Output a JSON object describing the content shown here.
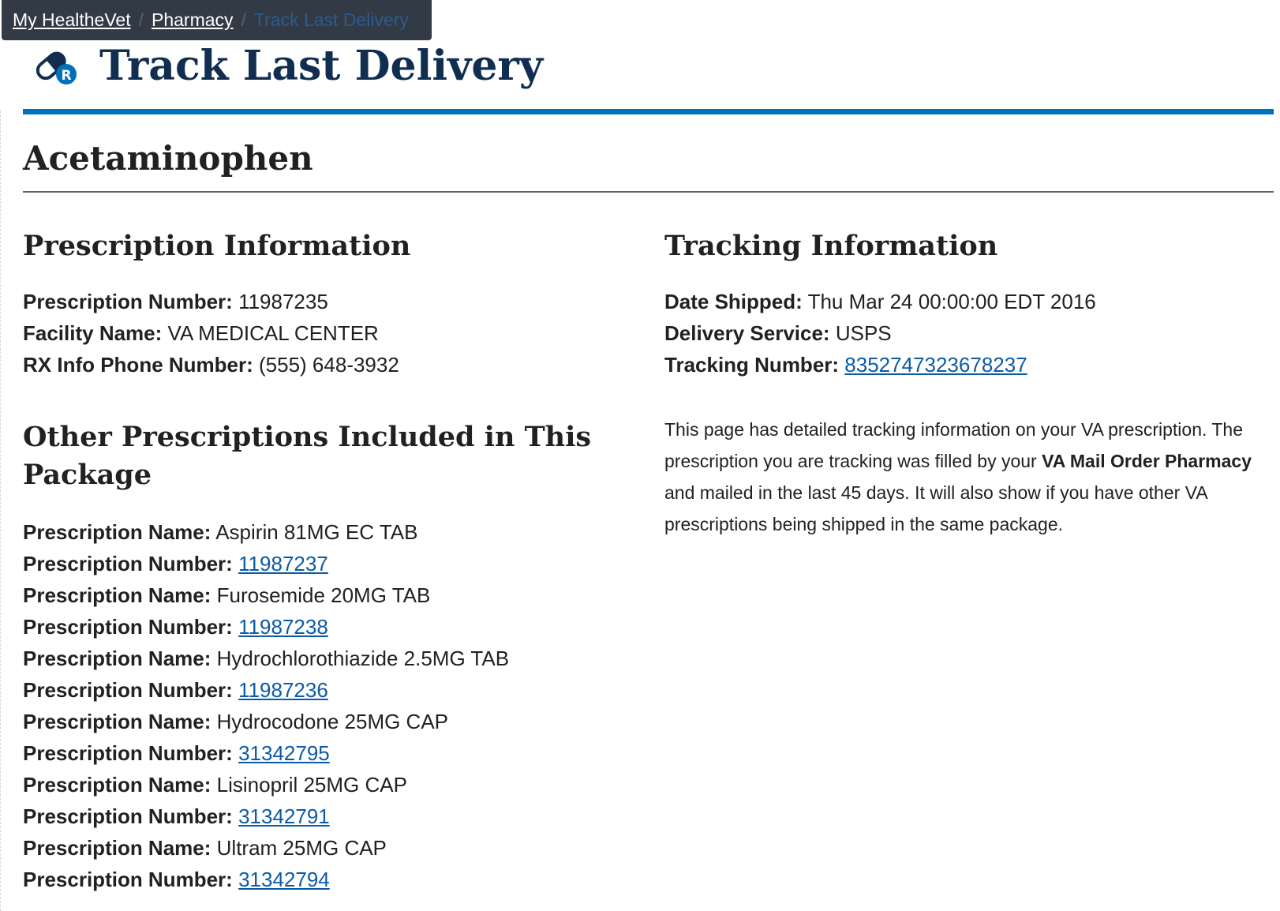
{
  "breadcrumb": {
    "items": [
      "My HealtheVet",
      "Pharmacy"
    ],
    "current": "Track Last Delivery",
    "separator": "/"
  },
  "header": {
    "title": "Track Last Delivery",
    "icon": "rx-pill-icon"
  },
  "drug_name": "Acetaminophen",
  "prescription_info": {
    "heading": "Prescription Information",
    "number_label": "Prescription Number:",
    "number_value": "11987235",
    "facility_label": "Facility Name:",
    "facility_value": "VA MEDICAL CENTER",
    "phone_label": "RX Info Phone Number:",
    "phone_value": "(555) 648-3932"
  },
  "other_prescriptions": {
    "heading": "Other Prescriptions Included in This Package",
    "name_label": "Prescription Name:",
    "number_label": "Prescription Number:",
    "items": [
      {
        "name": "Aspirin 81MG EC TAB",
        "number": "11987237"
      },
      {
        "name": "Furosemide 20MG TAB",
        "number": "11987238"
      },
      {
        "name": "Hydrochlorothiazide 2.5MG TAB",
        "number": "11987236"
      },
      {
        "name": "Hydrocodone 25MG CAP",
        "number": "31342795"
      },
      {
        "name": "Lisinopril 25MG CAP",
        "number": "31342791"
      },
      {
        "name": "Ultram 25MG CAP",
        "number": "31342794"
      }
    ]
  },
  "tracking_info": {
    "heading": "Tracking Information",
    "date_label": "Date Shipped:",
    "date_value": "Thu Mar 24 00:00:00 EDT 2016",
    "service_label": "Delivery Service:",
    "service_value": "USPS",
    "tracking_label": "Tracking Number:",
    "tracking_value": "8352747323678237"
  },
  "description": {
    "part1": "This page has detailed tracking information on your VA prescription. The prescription you are tracking was filled by your ",
    "bold": "VA Mail Order Pharmacy",
    "part2": " and mailed in the last 45 days. It will also show if you have other VA prescriptions being shipped in the same package."
  },
  "colors": {
    "breadcrumb_bg": "#323a45",
    "title": "#112e51",
    "accent_rule": "#0071bb",
    "link": "#0b5aa6",
    "icon_blue": "#0071bb"
  }
}
